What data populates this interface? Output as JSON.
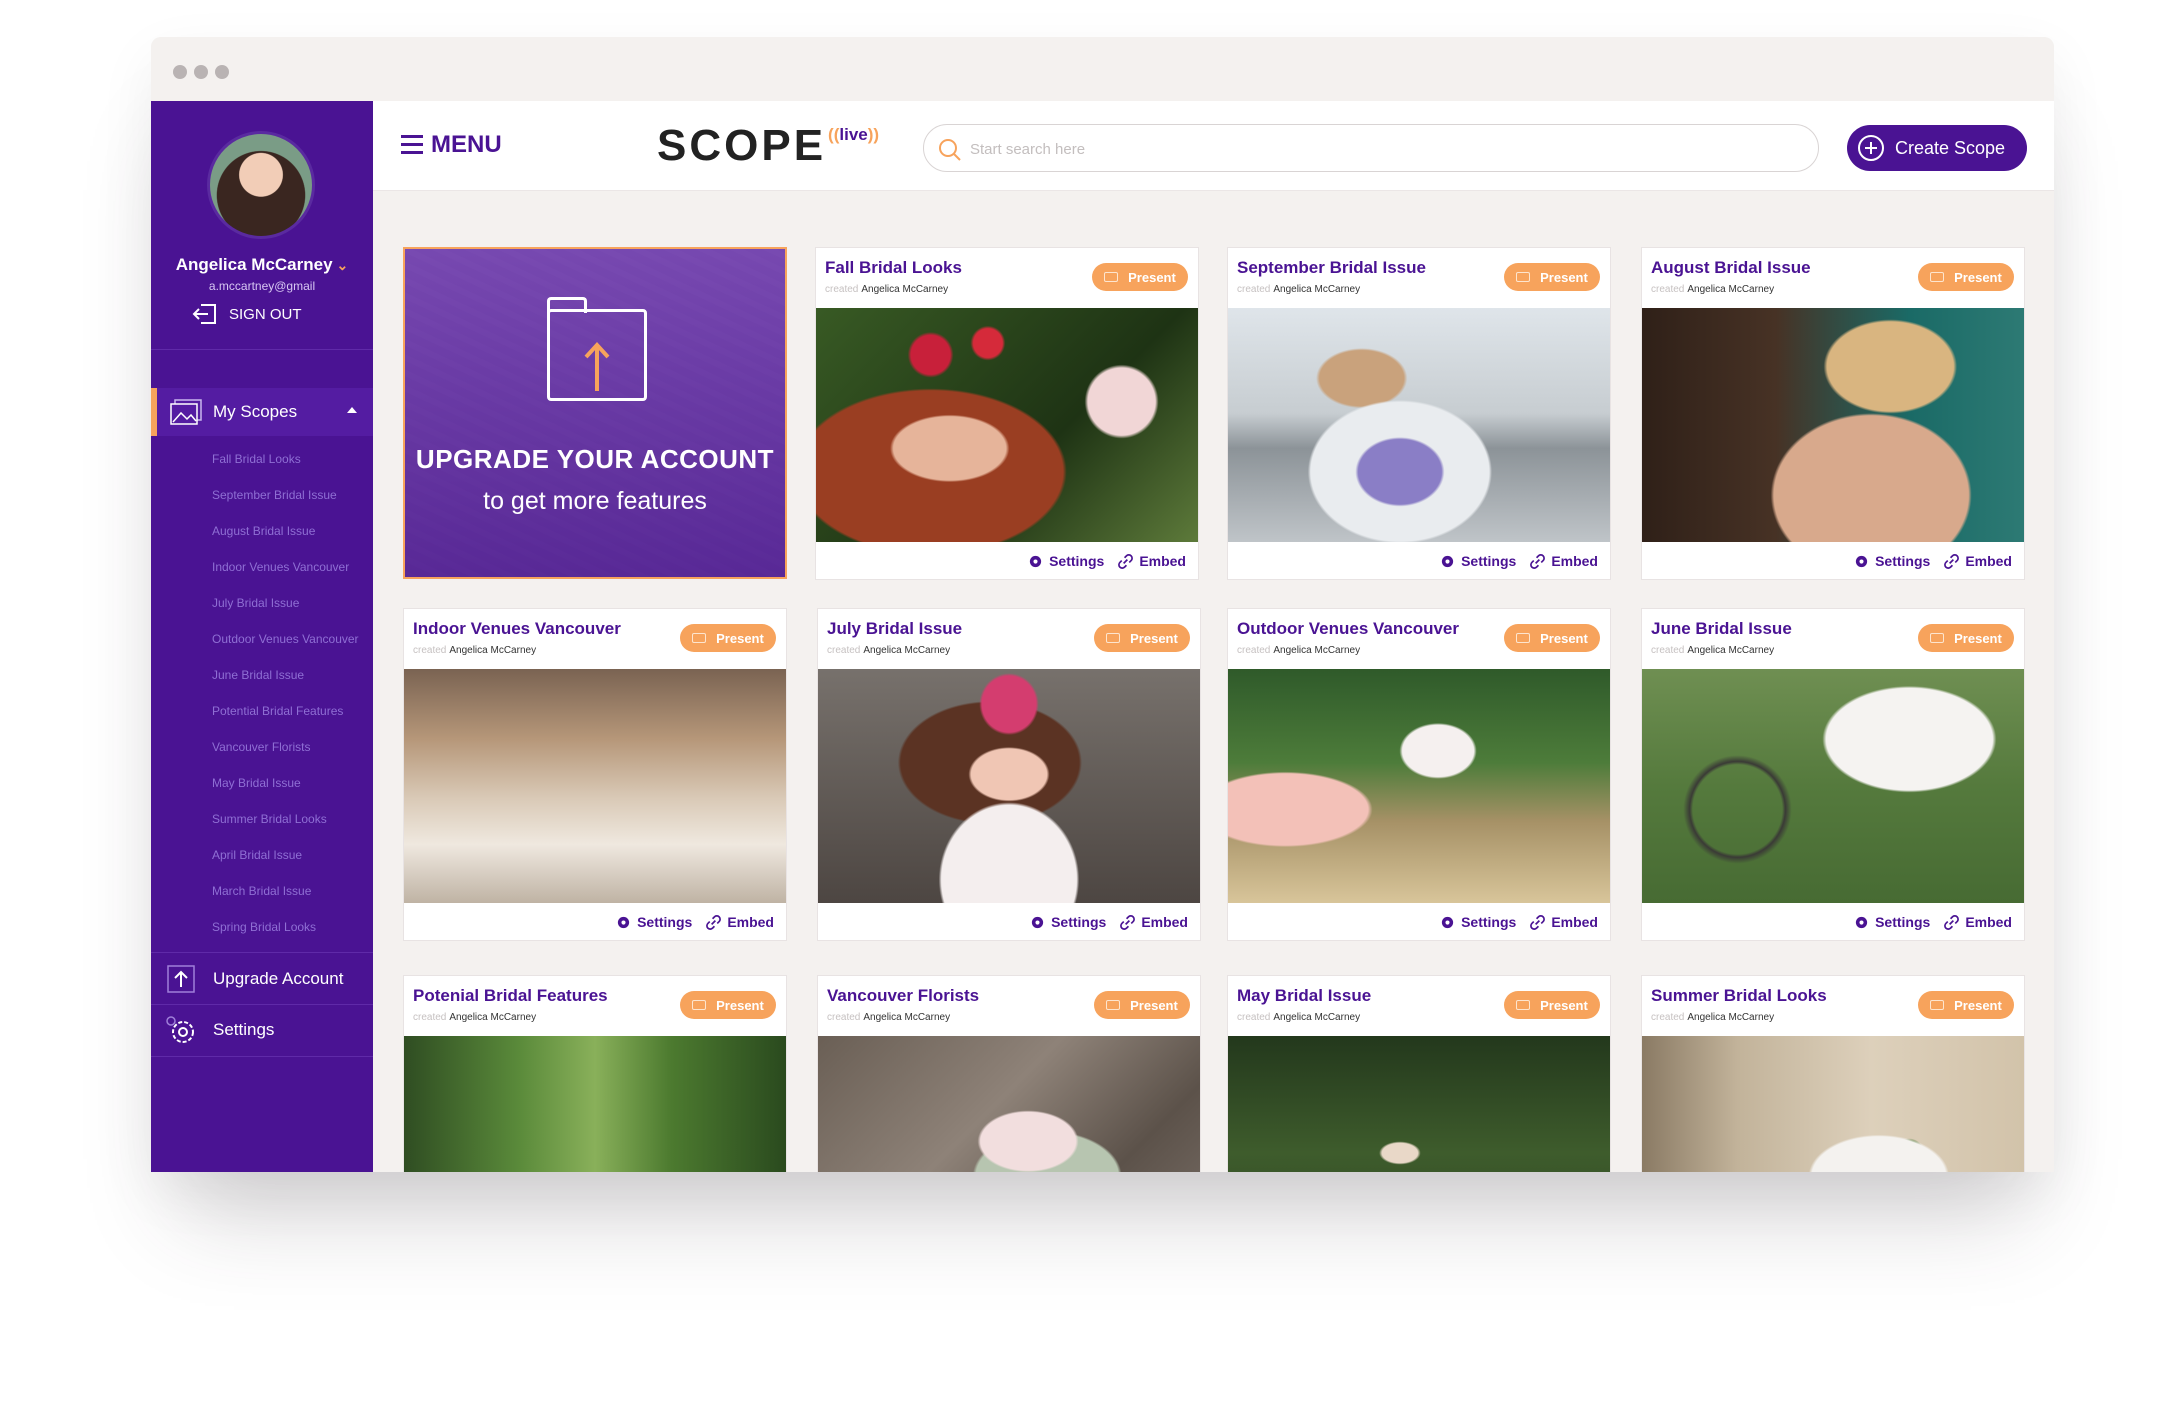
{
  "user": {
    "name": "Angelica McCarney",
    "email": "a.mccartney@gmail",
    "sign_out": "SIGN OUT"
  },
  "sidebar": {
    "my_scopes": "My Scopes",
    "items": [
      "Fall Bridal Looks",
      "September Bridal Issue",
      "August Bridal Issue",
      "Indoor Venues Vancouver",
      "July Bridal Issue",
      "Outdoor Venues Vancouver",
      "June Bridal Issue",
      "Potential Bridal Features",
      "Vancouver Florists",
      "May Bridal Issue",
      "Summer Bridal Looks",
      "April Bridal Issue",
      "March Bridal Issue",
      "Spring Bridal Looks"
    ],
    "upgrade": "Upgrade Account",
    "settings": "Settings"
  },
  "header": {
    "menu": "MENU",
    "logo": "SCOPE",
    "logo_live": "live",
    "search_placeholder": "Start search here",
    "create": "Create Scope"
  },
  "upgrade_card": {
    "title": "UPGRADE YOUR ACCOUNT",
    "subtitle": "to get more features"
  },
  "labels": {
    "created": "created",
    "present": "Present",
    "settings": "Settings",
    "embed": "Embed"
  },
  "cards": [
    {
      "title": "Fall Bridal Looks",
      "author": "Angelica McCarney"
    },
    {
      "title": "September Bridal Issue",
      "author": "Angelica McCarney"
    },
    {
      "title": "August Bridal Issue",
      "author": "Angelica McCarney"
    },
    {
      "title": "Indoor Venues Vancouver",
      "author": "Angelica McCarney"
    },
    {
      "title": "July Bridal Issue",
      "author": "Angelica McCarney"
    },
    {
      "title": "Outdoor Venues Vancouver",
      "author": "Angelica McCarney"
    },
    {
      "title": "June Bridal Issue",
      "author": "Angelica McCarney"
    },
    {
      "title": "Potenial Bridal Features",
      "author": "Angelica McCarney"
    },
    {
      "title": "Vancouver Florists",
      "author": "Angelica McCarney"
    },
    {
      "title": "May Bridal Issue",
      "author": "Angelica McCarney"
    },
    {
      "title": "Summer Bridal Looks",
      "author": "Angelica McCarney"
    }
  ],
  "colors": {
    "brand": "#4a1393",
    "accent": "#f7a35c",
    "sidebar": "#4a1393",
    "background": "#f4f1ef"
  }
}
